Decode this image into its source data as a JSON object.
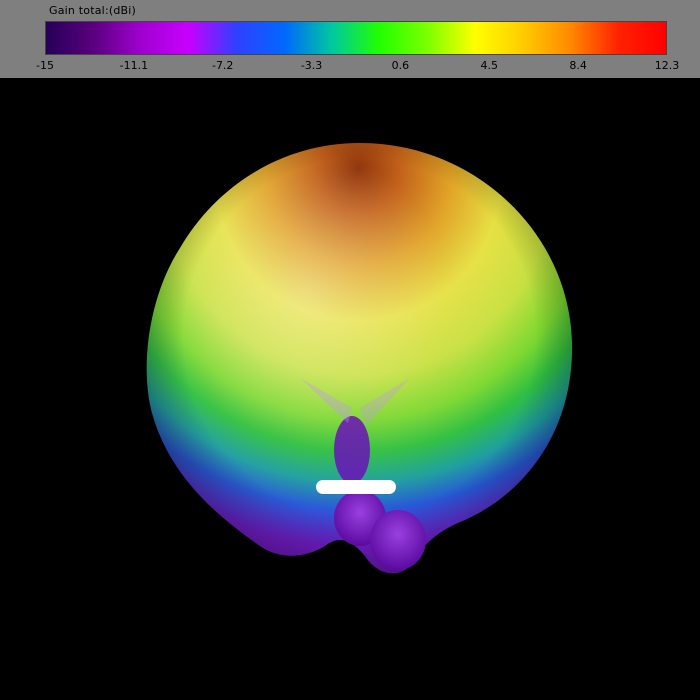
{
  "legend": {
    "title": "Gain total:(dBi)",
    "ticks": [
      "-15",
      "-11.1",
      "-7.2",
      "-3.3",
      "0.6",
      "4.5",
      "8.4",
      "12.3"
    ],
    "gradient_colors": [
      "#250058",
      "#5a007e",
      "#a000d0",
      "#c800ff",
      "#2f40ff",
      "#0068ff",
      "#00c8a0",
      "#22ff00",
      "#7cff00",
      "#ffff00",
      "#ffcc00",
      "#ff8800",
      "#ff2200",
      "#ff0000"
    ]
  },
  "chart_data": {
    "type": "3d-radiation-pattern",
    "quantity": "Gain total",
    "unit": "dBi",
    "colorbar_range": [
      -15,
      12.3
    ],
    "colorbar_ticks": [
      -15,
      -11.1,
      -7.2,
      -3.3,
      0.6,
      4.5,
      8.4,
      12.3
    ],
    "main_lobe_gain_max": 12.3,
    "back_lobe_gain_approx": -9
  }
}
